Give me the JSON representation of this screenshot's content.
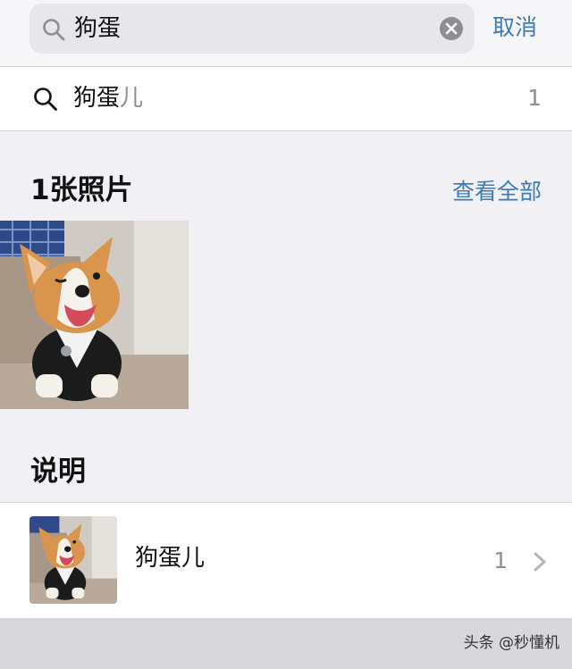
{
  "search": {
    "query": "狗蛋",
    "cancel_label": "取消"
  },
  "suggestion": {
    "typed": "狗蛋",
    "completion": "儿",
    "count": "1"
  },
  "photos_section": {
    "title": "1张照片",
    "see_all_label": "查看全部"
  },
  "captions_section": {
    "title": "说明",
    "item": {
      "label": "狗蛋儿",
      "count": "1"
    }
  },
  "watermark": "头条 @秒懂机",
  "icons": {
    "search": "search-icon",
    "clear": "clear-icon",
    "chevron": "chevron-right-icon"
  },
  "colors": {
    "accent": "#3e7ab5",
    "background": "#f0f0f5",
    "secondary_text": "#8e8e93"
  }
}
